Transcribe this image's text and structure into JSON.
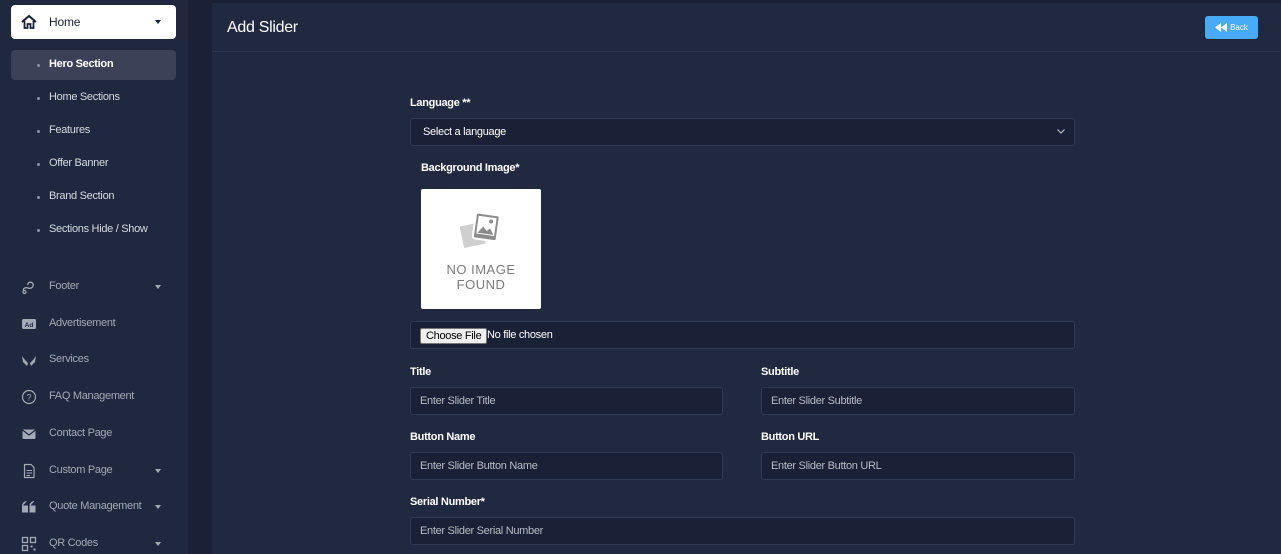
{
  "sidebar": {
    "home": {
      "label": "Home",
      "icon": "home-icon"
    },
    "sub_items": [
      {
        "label": "Hero Section",
        "active": true
      },
      {
        "label": "Home Sections",
        "active": false
      },
      {
        "label": "Features",
        "active": false
      },
      {
        "label": "Offer Banner",
        "active": false
      },
      {
        "label": "Brand Section",
        "active": false
      },
      {
        "label": "Sections Hide / Show",
        "active": false
      }
    ],
    "items": [
      {
        "label": "Footer",
        "icon": "footer-icon",
        "has_caret": true
      },
      {
        "label": "Advertisement",
        "icon": "ad-icon",
        "has_caret": false
      },
      {
        "label": "Services",
        "icon": "hands-icon",
        "has_caret": false
      },
      {
        "label": "FAQ Management",
        "icon": "question-icon",
        "has_caret": false
      },
      {
        "label": "Contact Page",
        "icon": "envelope-icon",
        "has_caret": false
      },
      {
        "label": "Custom Page",
        "icon": "file-icon",
        "has_caret": true
      },
      {
        "label": "Quote Management",
        "icon": "quote-icon",
        "has_caret": true
      },
      {
        "label": "QR Codes",
        "icon": "qrcode-icon",
        "has_caret": true
      }
    ]
  },
  "header": {
    "title": "Add Slider",
    "back_label": "Back"
  },
  "form": {
    "language_label": "Language **",
    "language_value": "Select a language",
    "background_label": "Background Image*",
    "no_image_line1": "NO IMAGE",
    "no_image_line2": "FOUND",
    "choose_file_label": "Choose File",
    "file_status": "No file chosen",
    "title_label": "Title",
    "title_placeholder": "Enter Slider Title",
    "subtitle_label": "Subtitle",
    "subtitle_placeholder": "Enter Slider Subtitle",
    "button_name_label": "Button Name",
    "button_name_placeholder": "Enter Slider Button Name",
    "button_url_label": "Button URL",
    "button_url_placeholder": "Enter Slider Button URL",
    "serial_label": "Serial Number*",
    "serial_placeholder": "Enter Slider Serial Number"
  },
  "colors": {
    "background": "#1a2035",
    "sidebar": "#1f283e",
    "card": "#202940",
    "accent": "#48abf7"
  }
}
